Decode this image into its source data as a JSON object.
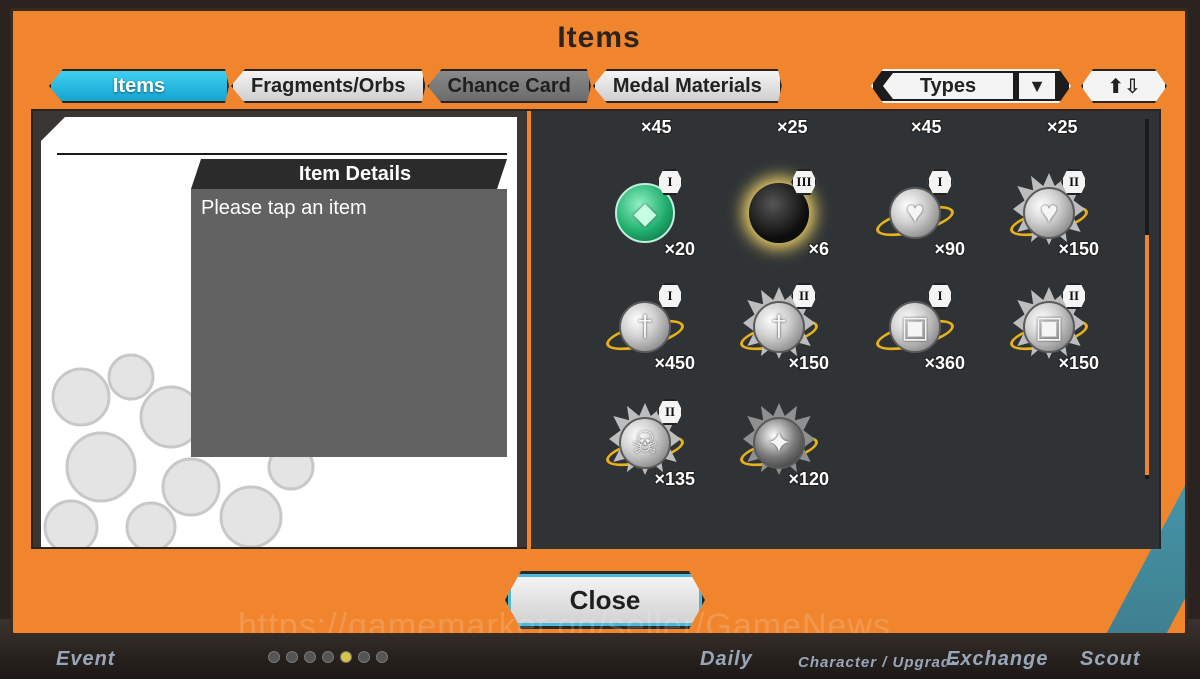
{
  "dialog": {
    "title": "Items"
  },
  "tabs": [
    {
      "label": "Items",
      "state": "active"
    },
    {
      "label": "Fragments/Orbs",
      "state": "light"
    },
    {
      "label": "Chance Card",
      "state": "dark"
    },
    {
      "label": "Medal Materials",
      "state": "light"
    }
  ],
  "filter": {
    "types_label": "Types",
    "chevron_icon": "chevron-down-icon",
    "sort_icon": "sort-up-down-icon",
    "sort_glyph": "⬆⇩"
  },
  "details": {
    "header": "Item Details",
    "hint": "Please tap an item"
  },
  "grid": {
    "top_partial_counts": [
      "×45",
      "×25",
      "×45",
      "×25"
    ],
    "rows": [
      [
        {
          "icon": "green-crystal-orb-icon",
          "rank": "I",
          "count": "×20"
        },
        {
          "icon": "black-orb-icon",
          "rank": "III",
          "count": "×6"
        },
        {
          "icon": "heart-emblem-icon",
          "rank": "I",
          "count": "×90"
        },
        {
          "icon": "heart-emblem-icon",
          "rank": "II",
          "count": "×150"
        }
      ],
      [
        {
          "icon": "sword-emblem-icon",
          "rank": "I",
          "count": "×450"
        },
        {
          "icon": "sword-emblem-icon",
          "rank": "II",
          "count": "×150"
        },
        {
          "icon": "armor-emblem-icon",
          "rank": "I",
          "count": "×360"
        },
        {
          "icon": "armor-emblem-icon",
          "rank": "II",
          "count": "×150"
        }
      ],
      [
        {
          "icon": "skull-emblem-icon",
          "rank": "II",
          "count": "×135"
        },
        {
          "icon": "sparkle-emblem-icon",
          "rank": "",
          "count": "×120"
        }
      ]
    ]
  },
  "close_label": "Close",
  "watermark": "https://gamemarket.gg/seller/GameNews",
  "bg_nav": [
    "Event",
    "Daily",
    "Character / Upgrade",
    "Exchange",
    "Scout"
  ],
  "colors": {
    "accent_orange": "#f0852d",
    "tab_active_blue": "#16a4d0",
    "ring_gold": "#f2b81a"
  }
}
